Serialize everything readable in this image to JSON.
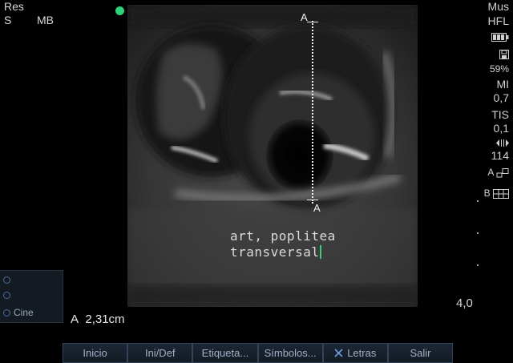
{
  "top_left": {
    "line1": "Res",
    "line2_left": "S",
    "line2_right": "MB"
  },
  "status_color": "#2fd17a",
  "right_panel": {
    "preset": "Mus",
    "transducer": "HFL",
    "battery_icon": "battery-icon",
    "storage_icon": "floppy-disk-icon",
    "storage_pct": "59%",
    "mi_label": "MI",
    "mi_value": "0,7",
    "tis_label": "TIS",
    "tis_value": "0,1",
    "gain_icon": "gain-icon",
    "gain_value": "114",
    "mode_a": "A",
    "mode_b": "B"
  },
  "caliper": {
    "top_label": "A",
    "bottom_label": "A"
  },
  "annotation": {
    "line1": "art, poplitea",
    "line2": "transversal"
  },
  "cine_panel": {
    "items": [
      "",
      "",
      "Cine"
    ]
  },
  "measurement": {
    "label": "A",
    "value": "2,31cm"
  },
  "depth": "4,0",
  "softkeys": [
    {
      "label": "Inicio"
    },
    {
      "label": "Ini/Def"
    },
    {
      "label": "Etiqueta..."
    },
    {
      "label": "Símbolos..."
    },
    {
      "label": "Letras",
      "icon": "x-icon"
    },
    {
      "label": "Salir"
    }
  ]
}
